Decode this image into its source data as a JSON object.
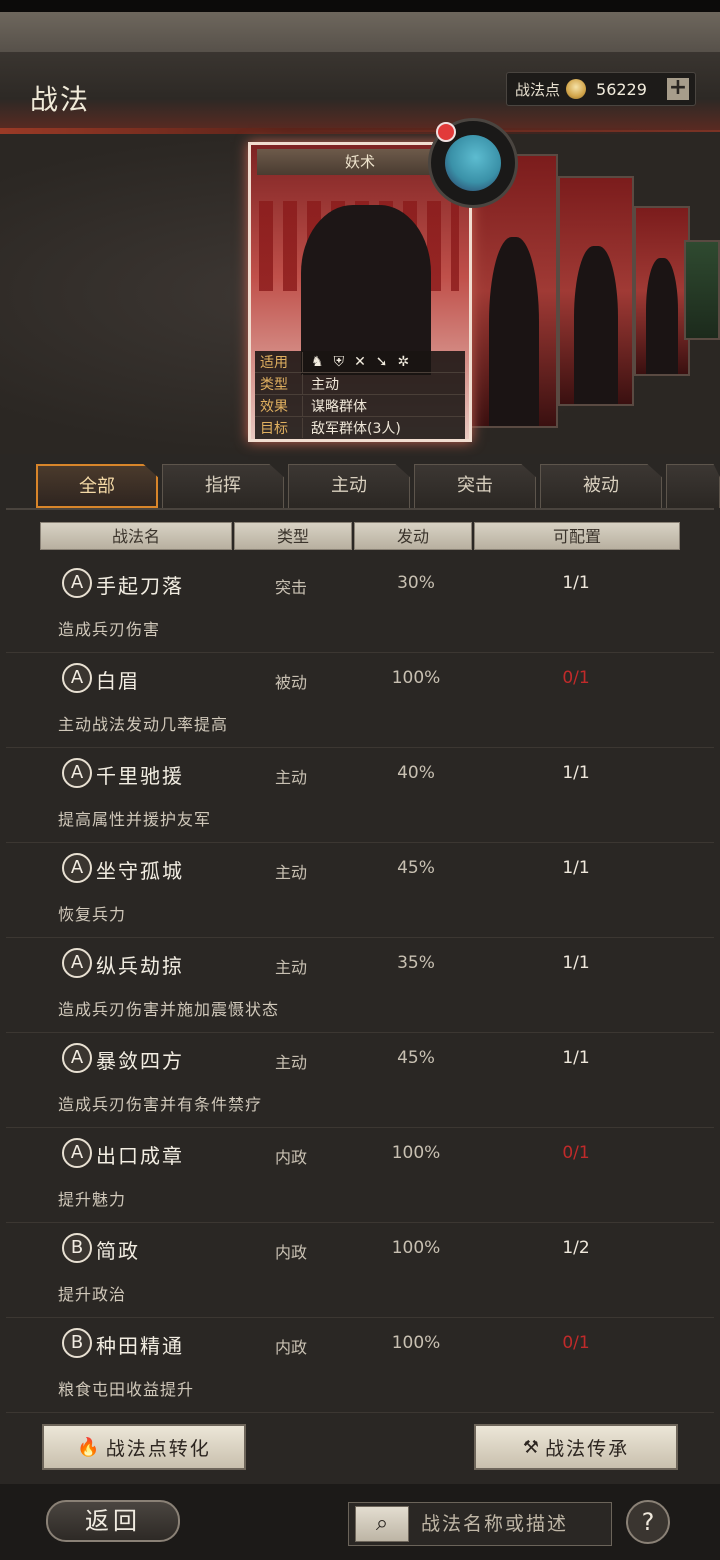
{
  "header": {
    "title": "战法",
    "points_label": "战法点",
    "points_value": "56229",
    "plus_label": "+"
  },
  "card": {
    "type_label": "妖术",
    "rows": [
      {
        "key": "适用",
        "value": ""
      },
      {
        "key": "类型",
        "value": "主动"
      },
      {
        "key": "效果",
        "value": "谋略群体"
      },
      {
        "key": "目标",
        "value": "敌军群体(3人)"
      }
    ],
    "unit_icons": [
      "cavalry-icon",
      "shield-icon",
      "bow-icon",
      "spear-icon",
      "chariot-icon"
    ]
  },
  "tabs": [
    "全部",
    "指挥",
    "主动",
    "突击",
    "被动"
  ],
  "table_headers": [
    "战法名",
    "类型",
    "发动",
    "可配置"
  ],
  "skills": [
    {
      "grade": "A",
      "name": "手起刀落",
      "type": "突击",
      "rate": "30%",
      "slots": "1/1",
      "full": false,
      "desc": "造成兵刃伤害"
    },
    {
      "grade": "A",
      "name": "白眉",
      "type": "被动",
      "rate": "100%",
      "slots": "0/1",
      "full": true,
      "desc": "主动战法发动几率提高"
    },
    {
      "grade": "A",
      "name": "千里驰援",
      "type": "主动",
      "rate": "40%",
      "slots": "1/1",
      "full": false,
      "desc": "提高属性并援护友军"
    },
    {
      "grade": "A",
      "name": "坐守孤城",
      "type": "主动",
      "rate": "45%",
      "slots": "1/1",
      "full": false,
      "desc": "恢复兵力"
    },
    {
      "grade": "A",
      "name": "纵兵劫掠",
      "type": "主动",
      "rate": "35%",
      "slots": "1/1",
      "full": false,
      "desc": "造成兵刃伤害并施加震慑状态"
    },
    {
      "grade": "A",
      "name": "暴敛四方",
      "type": "主动",
      "rate": "45%",
      "slots": "1/1",
      "full": false,
      "desc": "造成兵刃伤害并有条件禁疗"
    },
    {
      "grade": "A",
      "name": "出口成章",
      "type": "内政",
      "rate": "100%",
      "slots": "0/1",
      "full": true,
      "desc": "提升魅力"
    },
    {
      "grade": "B",
      "name": "简政",
      "type": "内政",
      "rate": "100%",
      "slots": "1/2",
      "full": false,
      "desc": "提升政治"
    },
    {
      "grade": "B",
      "name": "种田精通",
      "type": "内政",
      "rate": "100%",
      "slots": "0/1",
      "full": true,
      "desc": "粮食屯田收益提升"
    }
  ],
  "buttons": {
    "convert": "战法点转化",
    "inherit": "战法传承",
    "back": "返回",
    "help": "?"
  },
  "search": {
    "placeholder": "战法名称或描述"
  },
  "colors": {
    "slots_full": "#c02a2a",
    "tab_active_border": "#d8852a"
  }
}
